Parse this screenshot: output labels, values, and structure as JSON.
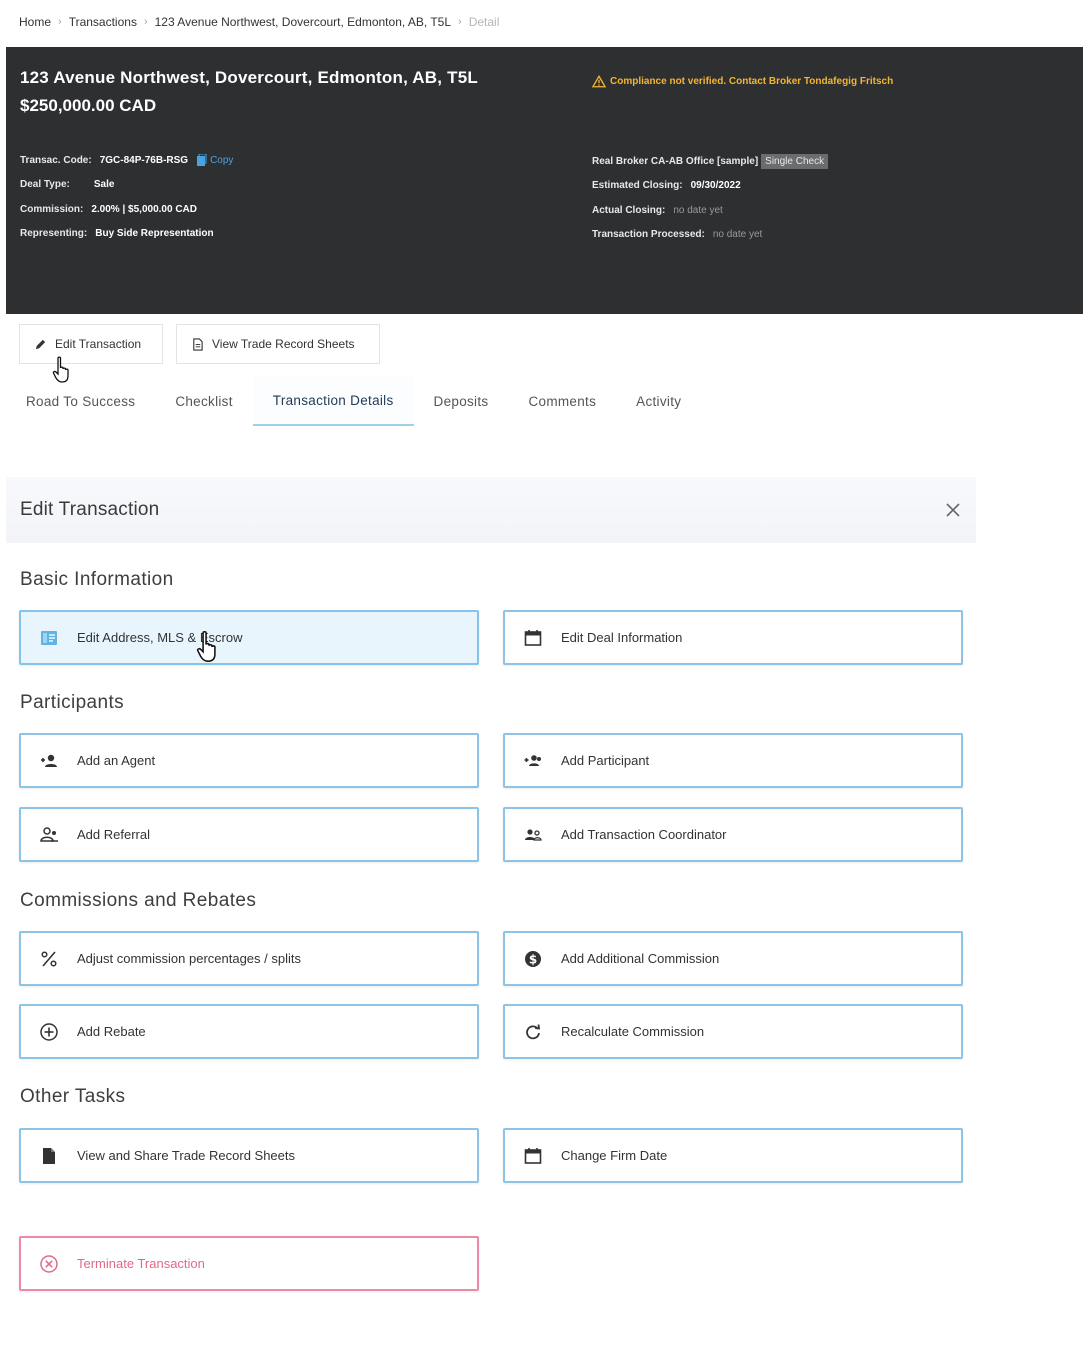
{
  "breadcrumb": {
    "home": "Home",
    "transactions": "Transactions",
    "address": "123 Avenue Northwest, Dovercourt, Edmonton, AB, T5L",
    "current": "Detail"
  },
  "header": {
    "title": "123 Avenue Northwest, Dovercourt, Edmonton, AB, T5L",
    "price": "$250,000.00 CAD",
    "warning": "Compliance not verified. Contact Broker Tondafegig Fritsch",
    "transac_code_label": "Transac. Code:",
    "transac_code_value": "7GC-84P-76B-RSG",
    "copy_label": "Copy",
    "deal_type_label": "Deal Type:",
    "deal_type_value": "Sale",
    "commission_label": "Commission:",
    "commission_value": "2.00% | $5,000.00 CAD",
    "representing_label": "Representing:",
    "representing_value": "Buy Side Representation",
    "office_value": "Real Broker CA-AB Office [sample]",
    "office_badge": "Single Check",
    "est_closing_label": "Estimated Closing:",
    "est_closing_value": "09/30/2022",
    "actual_closing_label": "Actual Closing:",
    "actual_closing_value": "no date yet",
    "processed_label": "Transaction Processed:",
    "processed_value": "no date yet",
    "warning_color": "#f2b632"
  },
  "actions": {
    "edit_transaction": "Edit Transaction",
    "view_trade_record": "View Trade Record Sheets"
  },
  "tabs": [
    "Road To Success",
    "Checklist",
    "Transaction Details",
    "Deposits",
    "Comments",
    "Activity"
  ],
  "active_tab": "Transaction Details",
  "panel": {
    "title": "Edit Transaction",
    "sections": {
      "basic": "Basic Information",
      "participants": "Participants",
      "commissions": "Commissions and Rebates",
      "other": "Other Tasks"
    },
    "options": {
      "edit_address": "Edit Address, MLS & Escrow",
      "edit_deal": "Edit Deal Information",
      "add_agent": "Add an Agent",
      "add_participant": "Add Participant",
      "add_referral": "Add Referral",
      "add_coordinator": "Add Transaction Coordinator",
      "adjust_commission": "Adjust commission percentages / splits",
      "add_additional_commission": "Add Additional Commission",
      "add_rebate": "Add Rebate",
      "recalculate": "Recalculate Commission",
      "view_share": "View and Share Trade Record Sheets",
      "change_firm_date": "Change Firm Date",
      "terminate": "Terminate Transaction"
    }
  },
  "colors": {
    "header_bg": "#2e2f31",
    "accent_border": "#8ec3e8",
    "danger": "#e26a88"
  }
}
